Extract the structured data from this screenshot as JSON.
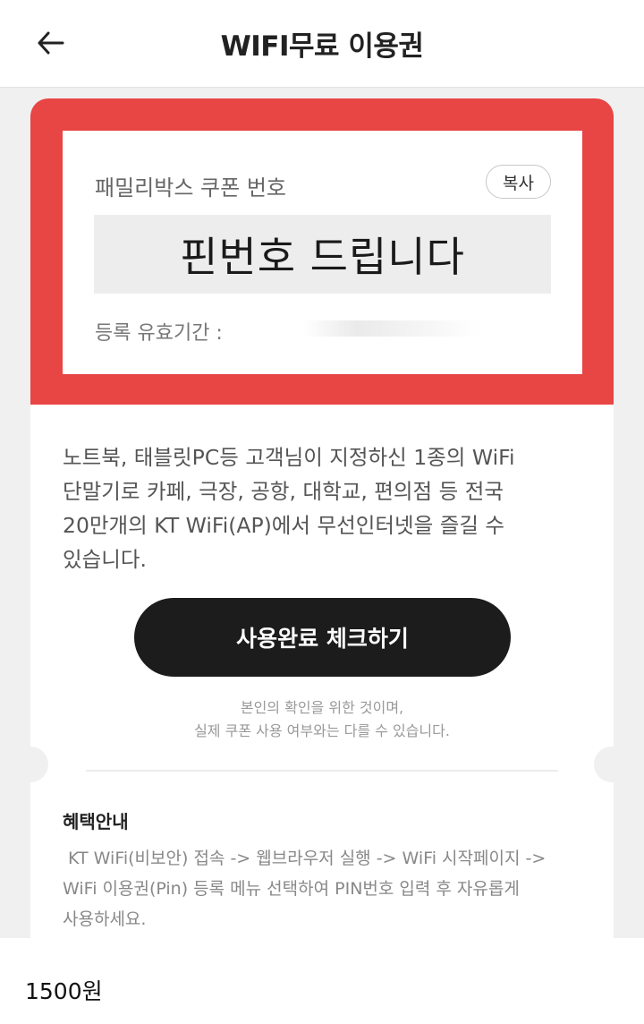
{
  "header": {
    "back_icon": "arrow-left-icon",
    "title": "WIFI무료 이용권"
  },
  "coupon": {
    "label": "패밀리박스 쿠폰 번호",
    "copy_label": "복사",
    "pin_value": "핀번호 드립니다",
    "validity_label": "등록 유효기간 :"
  },
  "description": {
    "lines": [
      "노트북, 태블릿PC등 고객님이 지정하신 1종의 WiFi",
      "단말기로 카페, 극장, 공항, 대학교, 편의점 등 전국",
      "20만개의 KT WiFi(AP)에서 무선인터넷을 즐길 수",
      "있습니다."
    ]
  },
  "check_button_label": "사용완료 체크하기",
  "notice": {
    "line1": "본인의 확인을 위한 것이며,",
    "line2": "실제 쿠폰 사용 여부와는 다를 수 있습니다."
  },
  "benefit": {
    "title": "혜택안내",
    "lines": [
      " KT WiFi(비보안) 접속 -> 웹브라우저 실행 -> WiFi 시작페이지 ->",
      "WiFi 이용권(Pin) 등록 메뉴 선택하여 PIN번호 입력 후 자유롭게",
      "사용하세요."
    ]
  },
  "price": "1500원",
  "colors": {
    "accent_red": "#e84545",
    "button_dark": "#1c1c1c"
  }
}
